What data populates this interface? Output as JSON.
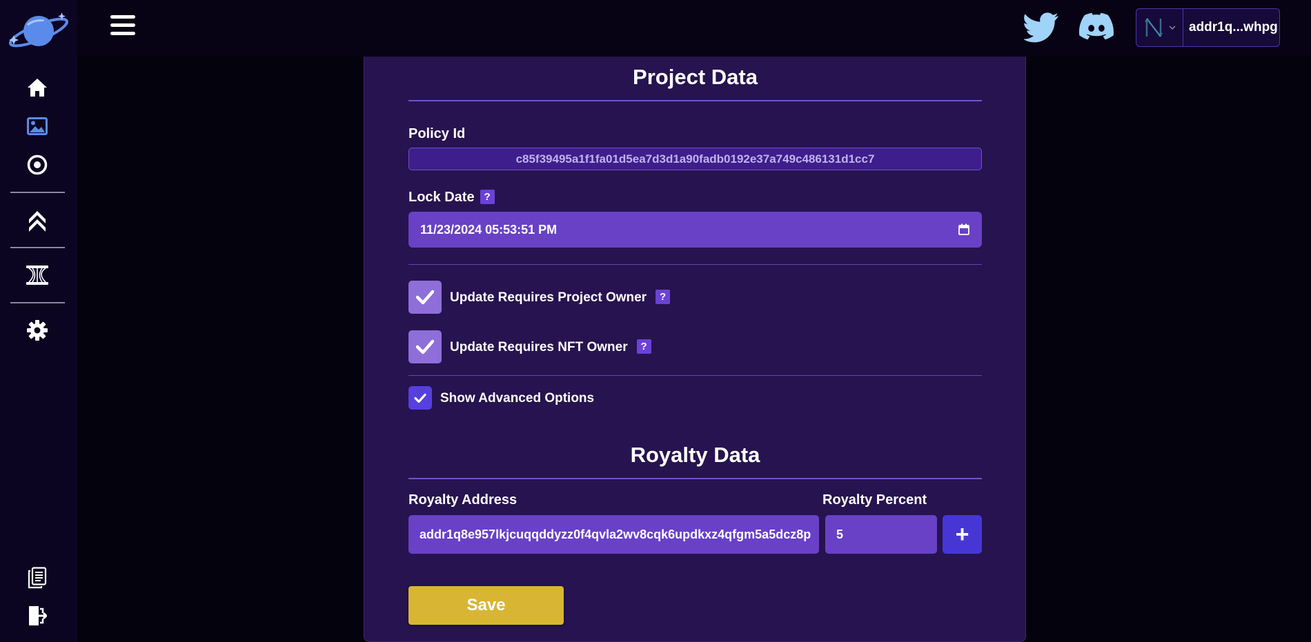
{
  "header": {
    "wallet_address": "addr1q...whpg"
  },
  "sidebar": {
    "items": [
      {
        "icon": "home-icon"
      },
      {
        "icon": "image-icon"
      },
      {
        "icon": "target-icon"
      },
      {
        "icon": "chevrons-up-icon"
      },
      {
        "icon": "hourglass-icon"
      },
      {
        "icon": "gear-icon"
      },
      {
        "icon": "document-icon"
      },
      {
        "icon": "logout-icon"
      }
    ]
  },
  "project": {
    "title": "Project Data",
    "policy_label": "Policy Id",
    "policy_id": "c85f39495a1f1fa01d5ea7d3d1a90fadb0192e37a749c486131d1cc7",
    "lock_label": "Lock Date",
    "help": "?",
    "lock_date": "11/23/2024 05:53:51 PM",
    "check_project_owner": "Update Requires Project Owner",
    "check_nft_owner": "Update Requires NFT Owner",
    "check_advanced": "Show Advanced Options"
  },
  "royalty": {
    "title": "Royalty Data",
    "address_label": "Royalty Address",
    "percent_label": "Royalty Percent",
    "address": "addr1q8e957lkjcuqqddyzz0f4qvla2wv8cqk6updkxz4qfgm5a5dcz8p",
    "percent": "5",
    "add_label": "+"
  },
  "actions": {
    "save_label": "Save"
  },
  "colors": {
    "accent": "#6841c6",
    "save": "#d9b534",
    "panel": "#27134f"
  }
}
